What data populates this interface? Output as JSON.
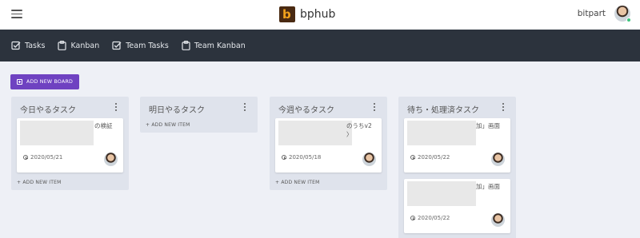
{
  "app": {
    "brand_name": "bphub",
    "logo_letter": "b"
  },
  "user": {
    "name": "bitpart"
  },
  "nav": {
    "items": [
      {
        "label": "Tasks",
        "icon": "check-square-icon"
      },
      {
        "label": "Kanban",
        "icon": "clipboard-icon"
      },
      {
        "label": "Team Tasks",
        "icon": "check-square-icon"
      },
      {
        "label": "Team Kanban",
        "icon": "clipboard-icon"
      }
    ]
  },
  "board": {
    "add_board_label": "ADD NEW BOARD",
    "add_item_label": "+ ADD NEW ITEM",
    "columns": [
      {
        "title": "今日やるタスク",
        "cards": [
          {
            "title_fragment": "の検証",
            "date": "2020/05/21"
          }
        ]
      },
      {
        "title": "明日やるタスク",
        "cards": []
      },
      {
        "title": "今週やるタスク",
        "cards": [
          {
            "title_fragment": "のうちv2",
            "title_fragment2": "〉",
            "date": "2020/05/18"
          }
        ]
      },
      {
        "title": "待ち・処理済タスク",
        "cards": [
          {
            "title_fragment": "加」画面",
            "date": "2020/05/22"
          },
          {
            "title_fragment": "加」画面",
            "date": "2020/05/22"
          }
        ]
      }
    ]
  },
  "colors": {
    "navbar": "#2c333d",
    "accent": "#6f42c1",
    "background": "#eef0f6",
    "column": "#dfe3ec"
  }
}
